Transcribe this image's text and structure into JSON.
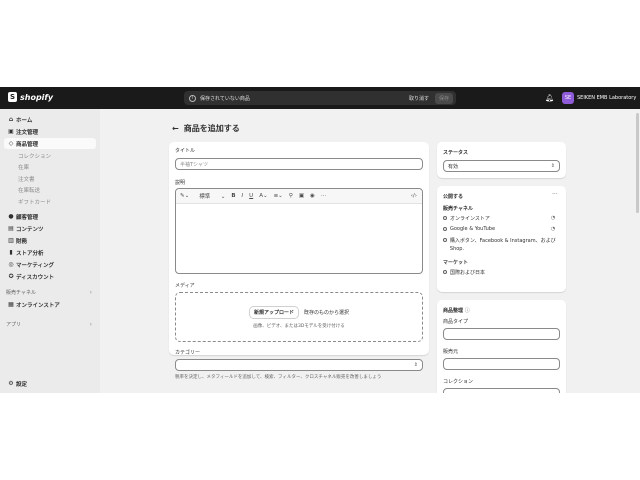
{
  "topbar": {
    "logo_text": "shopify",
    "logo_icon": "shopping-bag-icon",
    "search_text": "保存されていない商品",
    "undo_label": "取り消す",
    "save_label": "保存",
    "avatar_initials": "SE",
    "store_name": "SEIKEN EMB Laboratory"
  },
  "sidebar": {
    "items": [
      {
        "label": "ホーム",
        "icon": "home-icon"
      },
      {
        "label": "注文管理",
        "icon": "inbox-icon"
      },
      {
        "label": "商品管理",
        "icon": "tag-icon"
      },
      {
        "label": "コレクション"
      },
      {
        "label": "在庫"
      },
      {
        "label": "注文書"
      },
      {
        "label": "在庫転送"
      },
      {
        "label": "ギフトカード"
      },
      {
        "label": "顧客管理",
        "icon": "person-icon"
      },
      {
        "label": "コンテンツ",
        "icon": "content-icon"
      },
      {
        "label": "財務",
        "icon": "bank-icon"
      },
      {
        "label": "ストア分析",
        "icon": "chart-icon"
      },
      {
        "label": "マーケティング",
        "icon": "target-icon"
      },
      {
        "label": "ディスカウント",
        "icon": "discount-icon"
      },
      {
        "label": "販売チャネル"
      },
      {
        "label": "オンラインストア",
        "icon": "store-icon"
      },
      {
        "label": "アプリ"
      },
      {
        "label": "設定",
        "icon": "gear-icon"
      }
    ]
  },
  "main": {
    "page_title": "商品を追加する",
    "title_label": "タイトル",
    "title_placeholder": "半袖Tシャツ",
    "description_label": "説明",
    "editor_style": "標準",
    "media_label": "メディア",
    "upload_new": "新規アップロード",
    "select_existing": "既存のものから選択",
    "media_hint": "画像、ビデオ、または3Dモデルを受け付ける",
    "category_label": "カテゴリー",
    "category_hint": "税率を決定し、メタフィールドを追加して、検索、フィルター、クロスチャネル販売を改善しましょう"
  },
  "status_card": {
    "heading": "ステータス",
    "value": "有効"
  },
  "publish_card": {
    "heading": "公開する",
    "channels_heading": "販売チャネル",
    "channels": [
      "オンラインストア",
      "Google & YouTube",
      "購入ボタン、Facebook & Instagram、およびShop."
    ],
    "market_heading": "マーケット",
    "markets": [
      "国際および日本"
    ]
  },
  "org_card": {
    "heading": "商品整理",
    "type_label": "商品タイプ",
    "vendor_label": "販売元",
    "collection_label": "コレクション"
  }
}
